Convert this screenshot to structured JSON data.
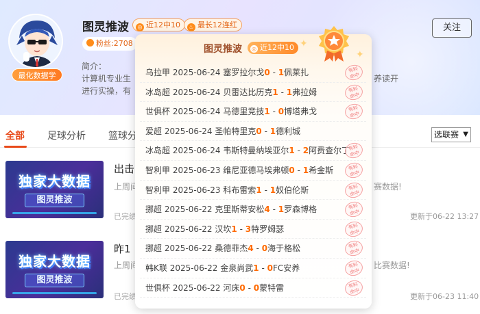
{
  "profile": {
    "name": "图灵推波",
    "tag_record": "近12中10",
    "tag_streak": "最长12连红",
    "tag_record_icon": "target-icon",
    "tag_streak_icon": "flame-icon",
    "avatar_badge": "最化数据学",
    "fans": "粉丝:2708",
    "intro_label": "简介：",
    "intro_text": "计算机专业生进行实操，有",
    "intro_tail": "养读开",
    "follow_label": "关注"
  },
  "tabs": [
    {
      "label": "全部",
      "active": true
    },
    {
      "label": "足球分析",
      "active": false
    },
    {
      "label": "篮球分",
      "active": false
    }
  ],
  "filter": {
    "label": "选联赛",
    "chevron": "chevron-down-icon"
  },
  "articles": [
    {
      "thumb_line1": "独家大数据",
      "thumb_line2": "图灵推波",
      "title": "出击",
      "desc": "上周间",
      "desc_tail": "赛数据!",
      "status": "已完绩",
      "time": "更新于06-22 13:27"
    },
    {
      "thumb_line1": "独家大数据",
      "thumb_line2": "图灵推波",
      "title": "昨1",
      "desc": "上周间",
      "desc_tail": "比赛数据!",
      "status": "已完绩",
      "time": "更新于06-23 11:40"
    }
  ],
  "popover": {
    "title": "图灵推波",
    "tag": "近12中10",
    "medal_icon": "medal-icon",
    "stamp_text": "有料 命中",
    "matches": [
      {
        "league": "乌拉甲",
        "date": "2025-06-24",
        "home": "塞罗拉尔戈",
        "hs": "0",
        "as": "1",
        "away": "佩莱扎",
        "hit": true
      },
      {
        "league": "冰岛超",
        "date": "2025-06-24",
        "home": "贝雷达比历克",
        "hs": "1",
        "as": "1",
        "away": "弗拉姆",
        "hit": true
      },
      {
        "league": "世俱杯",
        "date": "2025-06-24",
        "home": "马德里竞技",
        "hs": "1",
        "as": "0",
        "away": "博塔弗戈",
        "hit": true
      },
      {
        "league": "爱超",
        "date": "2025-06-24",
        "home": "圣帕特里克",
        "hs": "0",
        "as": "1",
        "away": "德利城",
        "hit": false
      },
      {
        "league": "冰岛超",
        "date": "2025-06-24",
        "home": "韦斯特曼纳埃亚尔",
        "hs": "1",
        "as": "2",
        "away": "阿费查尔丁",
        "hit": true
      },
      {
        "league": "智利甲",
        "date": "2025-06-23",
        "home": "维尼亚德马埃弗顿",
        "hs": "0",
        "as": "1",
        "away": "希金斯",
        "hit": true
      },
      {
        "league": "智利甲",
        "date": "2025-06-23",
        "home": "科布雷索",
        "hs": "1",
        "as": "1",
        "away": "奴伯伦斯",
        "hit": true
      },
      {
        "league": "挪超",
        "date": "2025-06-22",
        "home": "克里斯蒂安松",
        "hs": "4",
        "as": "1",
        "away": "罗森博格",
        "hit": true
      },
      {
        "league": "挪超",
        "date": "2025-06-22",
        "home": "汉坎",
        "hs": "1",
        "as": "3",
        "away": "特罗姆瑟",
        "hit": true
      },
      {
        "league": "挪超",
        "date": "2025-06-22",
        "home": "桑德菲杰",
        "hs": "4",
        "as": "0",
        "away": "海于格松",
        "hit": true
      },
      {
        "league": "韩K联",
        "date": "2025-06-22",
        "home": "金泉尚武",
        "hs": "1",
        "as": "0",
        "away": "FC安养",
        "hit": true
      },
      {
        "league": "世俱杯",
        "date": "2025-06-22",
        "home": "河床",
        "hs": "0",
        "as": "0",
        "away": "蒙特雷",
        "hit": true
      }
    ]
  }
}
